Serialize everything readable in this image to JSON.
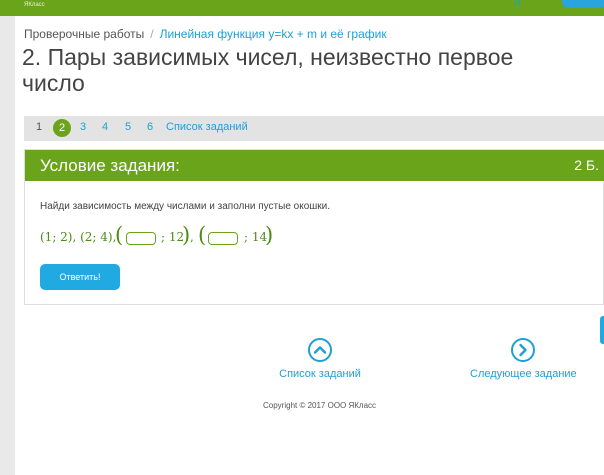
{
  "header": {
    "brand": "ЯКласс",
    "top_link": "д",
    "accent": "#6aa41b",
    "link_color": "#1e9fd8"
  },
  "breadcrumb": {
    "items": [
      "Проверочные работы",
      "Линейная функция y=kx + m и её график"
    ],
    "separator": "/"
  },
  "page_title": "2. Пары зависимых чисел, неизвестно первое число",
  "pager": {
    "pages": [
      "1",
      "2",
      "3",
      "4",
      "5",
      "6"
    ],
    "active": "2",
    "task_list_label": "Список заданий"
  },
  "task": {
    "header_title": "Условие задания:",
    "points": "2 Б.",
    "instruction": "Найди зависимость между числами и заполни пустые окошки.",
    "math": {
      "given": "(1; 2),  (2; 4),",
      "pair3_second": "; 12",
      "comma": ",",
      "pair4_second": "; 14",
      "open_paren": "(",
      "close_paren": ")",
      "answer_inputs": [
        "",
        ""
      ]
    },
    "answer_button": "Ответить!"
  },
  "navigation": {
    "task_list": "Список заданий",
    "next_task": "Следующее задание"
  },
  "footer": {
    "copyright": "Copyright © 2017 ООО ЯКласс"
  }
}
